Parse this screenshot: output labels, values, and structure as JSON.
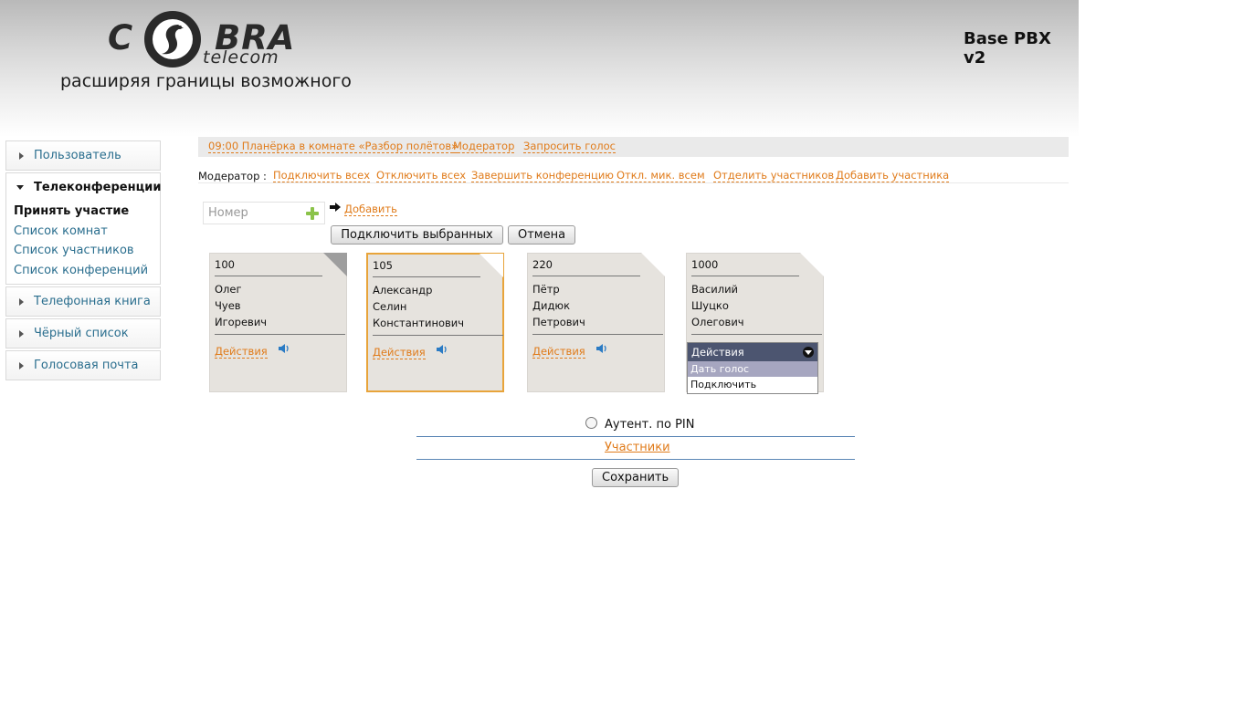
{
  "header": {
    "logo_left": "C",
    "logo_right": "BRA",
    "logo_sub": "telecom",
    "tagline": "расширяя границы возможного",
    "product": "Base PBX v2"
  },
  "sidebar": {
    "sections": [
      {
        "label": "Пользователь"
      },
      {
        "label": "Телеконференции",
        "items": [
          "Принять участие",
          "Список комнат",
          "Список участников",
          "Список конференций"
        ]
      },
      {
        "label": "Телефонная книга"
      },
      {
        "label": "Чёрный список"
      },
      {
        "label": "Голосовая почта"
      }
    ]
  },
  "topbar": {
    "meeting": "09:00 Планёрка в комнате «Разбор полётов»",
    "moderator": "Модератор",
    "request_voice": "Запросить голос"
  },
  "moderator_row": {
    "label": "Модератор :",
    "actions": [
      "Подключить всех",
      "Отключить всех",
      "Завершить конференцию",
      "Откл. мик. всем",
      "Отделить участников",
      "Добавить участника"
    ]
  },
  "add_form": {
    "placeholder": "Номер",
    "add_label": "Добавить",
    "connect_selected": "Подключить выбранных",
    "cancel": "Отмена"
  },
  "cards": [
    {
      "number": "100",
      "first": "Олег",
      "last": "Чуев",
      "middle": "Игоревич",
      "actions": "Действия"
    },
    {
      "number": "105",
      "first": "Александр",
      "last": "Селин",
      "middle": "Константинович",
      "actions": "Действия"
    },
    {
      "number": "220",
      "first": "Пётр",
      "last": "Дидюк",
      "middle": "Петрович",
      "actions": "Действия"
    },
    {
      "number": "1000",
      "first": "Василий",
      "last": "Шуцко",
      "middle": "Олегович",
      "actions": "Действия"
    }
  ],
  "dropdown": {
    "label": "Действия",
    "options": [
      "Дать голос",
      "Подключить"
    ]
  },
  "bottom": {
    "pin_auth": "Аутент. по PIN",
    "participants": "Участники",
    "save": "Сохранить"
  },
  "colors": {
    "link": "#e07b1a",
    "nav_link": "#2a6e8e",
    "dropdown_head": "#4c5570",
    "selected_border": "#e8a43a"
  }
}
